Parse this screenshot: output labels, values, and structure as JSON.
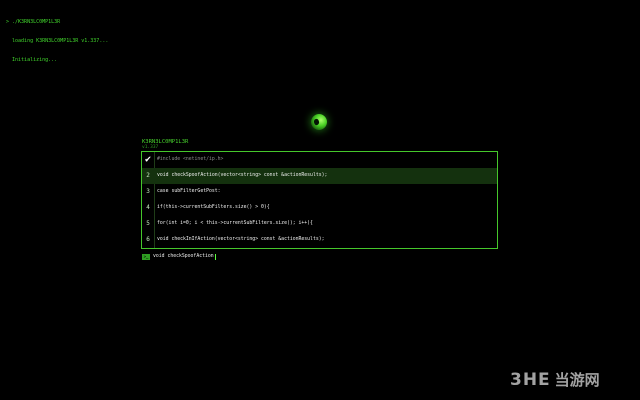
{
  "terminal": {
    "lines": [
      "> ./K3RN3LC0MP1L3R",
      "  loading K3RN3LC0MP1L3R v1.337...",
      "  Initializing..."
    ]
  },
  "app": {
    "title": "K3RN3LC0MP1L3R",
    "version": "v1.337"
  },
  "editor": {
    "lines": [
      {
        "num": "✔",
        "code": "#include <netinet/ip.h>"
      },
      {
        "num": "2",
        "code": "void checkSpoofAction(vector<string> const &actionResults);"
      },
      {
        "num": "3",
        "code": "case subFilterGetPost:"
      },
      {
        "num": "4",
        "code": "if(this->currentSubFilters.size() > 0){"
      },
      {
        "num": "5",
        "code": "for(int i=0; i < this->currentSubFilters.size(); i++){"
      },
      {
        "num": "6",
        "code": "void checkInIfAction(vector<string> const &actionResults);"
      }
    ]
  },
  "prompt": {
    "icon": ">_",
    "input_value": "void checkSpoofAction"
  },
  "watermark": {
    "logo": "3HE",
    "text": "当游网"
  },
  "colors": {
    "accent": "#45c72b",
    "text_green": "#41d52c",
    "active_row": "#14310e"
  }
}
